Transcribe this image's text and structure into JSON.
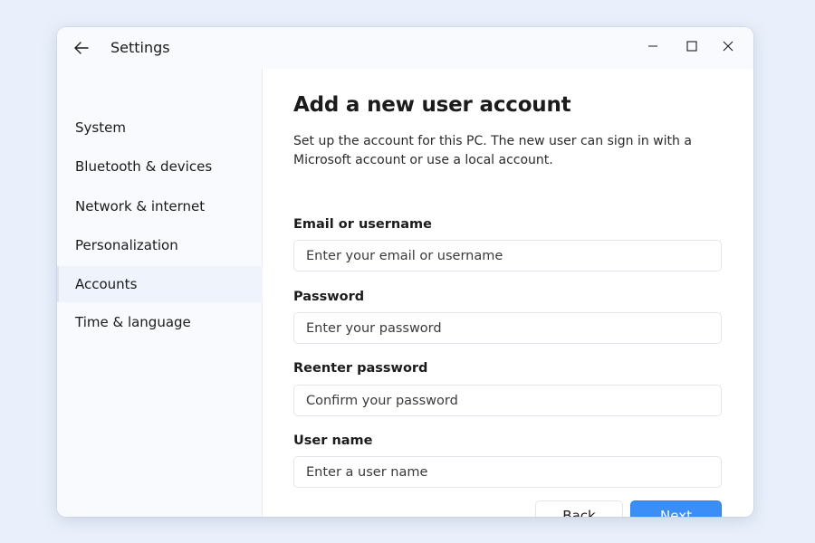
{
  "window": {
    "title": "Settings"
  },
  "sidebar": {
    "items": [
      {
        "label": "System"
      },
      {
        "label": "Bluetooth & devices"
      },
      {
        "label": "Network & internet"
      },
      {
        "label": "Personalization"
      },
      {
        "label": "Accounts",
        "selected": true
      },
      {
        "label": "Time & language"
      }
    ]
  },
  "main": {
    "heading": "Add a new user account",
    "description": "Set up the account for this PC. The new user can sign in with a Microsoft account or use a local account.",
    "fields": [
      {
        "label": "Email or username",
        "value": "",
        "placeholder": "Enter your email or username"
      },
      {
        "label": "Password",
        "value": "",
        "placeholder": "Enter your password"
      },
      {
        "label": "Reenter password",
        "value": "",
        "placeholder": "Confirm your password"
      },
      {
        "label": "User name",
        "value": "",
        "placeholder": "Enter a user name"
      }
    ],
    "buttons": {
      "back_label": "Back",
      "next_label": "Next"
    }
  },
  "icons": {
    "back": "arrow-left-icon",
    "minimize": "minimize-icon",
    "maximize": "maximize-icon",
    "close": "close-icon"
  },
  "colors": {
    "accent": "#3b8ef5",
    "background": "#e9f0fb",
    "selected_nav": "#eef3fc"
  }
}
